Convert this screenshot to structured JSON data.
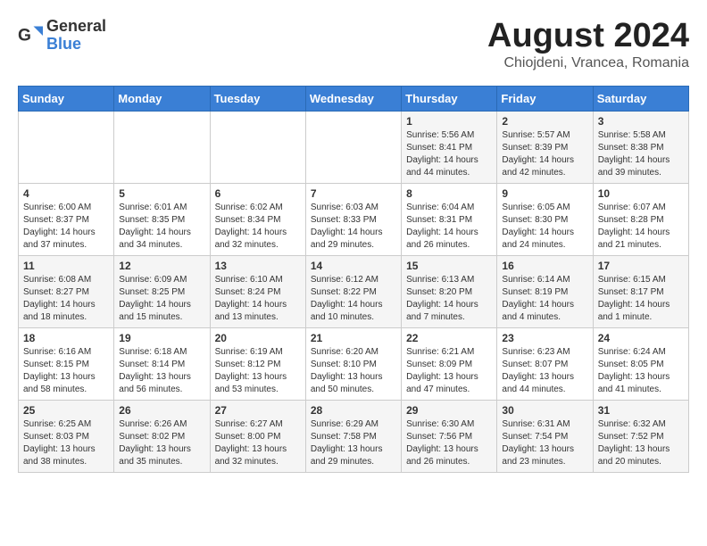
{
  "header": {
    "logo_general": "General",
    "logo_blue": "Blue",
    "month_year": "August 2024",
    "location": "Chiojdeni, Vrancea, Romania"
  },
  "weekdays": [
    "Sunday",
    "Monday",
    "Tuesday",
    "Wednesday",
    "Thursday",
    "Friday",
    "Saturday"
  ],
  "weeks": [
    [
      {
        "day": "",
        "content": ""
      },
      {
        "day": "",
        "content": ""
      },
      {
        "day": "",
        "content": ""
      },
      {
        "day": "",
        "content": ""
      },
      {
        "day": "1",
        "content": "Sunrise: 5:56 AM\nSunset: 8:41 PM\nDaylight: 14 hours and 44 minutes."
      },
      {
        "day": "2",
        "content": "Sunrise: 5:57 AM\nSunset: 8:39 PM\nDaylight: 14 hours and 42 minutes."
      },
      {
        "day": "3",
        "content": "Sunrise: 5:58 AM\nSunset: 8:38 PM\nDaylight: 14 hours and 39 minutes."
      }
    ],
    [
      {
        "day": "4",
        "content": "Sunrise: 6:00 AM\nSunset: 8:37 PM\nDaylight: 14 hours and 37 minutes."
      },
      {
        "day": "5",
        "content": "Sunrise: 6:01 AM\nSunset: 8:35 PM\nDaylight: 14 hours and 34 minutes."
      },
      {
        "day": "6",
        "content": "Sunrise: 6:02 AM\nSunset: 8:34 PM\nDaylight: 14 hours and 32 minutes."
      },
      {
        "day": "7",
        "content": "Sunrise: 6:03 AM\nSunset: 8:33 PM\nDaylight: 14 hours and 29 minutes."
      },
      {
        "day": "8",
        "content": "Sunrise: 6:04 AM\nSunset: 8:31 PM\nDaylight: 14 hours and 26 minutes."
      },
      {
        "day": "9",
        "content": "Sunrise: 6:05 AM\nSunset: 8:30 PM\nDaylight: 14 hours and 24 minutes."
      },
      {
        "day": "10",
        "content": "Sunrise: 6:07 AM\nSunset: 8:28 PM\nDaylight: 14 hours and 21 minutes."
      }
    ],
    [
      {
        "day": "11",
        "content": "Sunrise: 6:08 AM\nSunset: 8:27 PM\nDaylight: 14 hours and 18 minutes."
      },
      {
        "day": "12",
        "content": "Sunrise: 6:09 AM\nSunset: 8:25 PM\nDaylight: 14 hours and 15 minutes."
      },
      {
        "day": "13",
        "content": "Sunrise: 6:10 AM\nSunset: 8:24 PM\nDaylight: 14 hours and 13 minutes."
      },
      {
        "day": "14",
        "content": "Sunrise: 6:12 AM\nSunset: 8:22 PM\nDaylight: 14 hours and 10 minutes."
      },
      {
        "day": "15",
        "content": "Sunrise: 6:13 AM\nSunset: 8:20 PM\nDaylight: 14 hours and 7 minutes."
      },
      {
        "day": "16",
        "content": "Sunrise: 6:14 AM\nSunset: 8:19 PM\nDaylight: 14 hours and 4 minutes."
      },
      {
        "day": "17",
        "content": "Sunrise: 6:15 AM\nSunset: 8:17 PM\nDaylight: 14 hours and 1 minute."
      }
    ],
    [
      {
        "day": "18",
        "content": "Sunrise: 6:16 AM\nSunset: 8:15 PM\nDaylight: 13 hours and 58 minutes."
      },
      {
        "day": "19",
        "content": "Sunrise: 6:18 AM\nSunset: 8:14 PM\nDaylight: 13 hours and 56 minutes."
      },
      {
        "day": "20",
        "content": "Sunrise: 6:19 AM\nSunset: 8:12 PM\nDaylight: 13 hours and 53 minutes."
      },
      {
        "day": "21",
        "content": "Sunrise: 6:20 AM\nSunset: 8:10 PM\nDaylight: 13 hours and 50 minutes."
      },
      {
        "day": "22",
        "content": "Sunrise: 6:21 AM\nSunset: 8:09 PM\nDaylight: 13 hours and 47 minutes."
      },
      {
        "day": "23",
        "content": "Sunrise: 6:23 AM\nSunset: 8:07 PM\nDaylight: 13 hours and 44 minutes."
      },
      {
        "day": "24",
        "content": "Sunrise: 6:24 AM\nSunset: 8:05 PM\nDaylight: 13 hours and 41 minutes."
      }
    ],
    [
      {
        "day": "25",
        "content": "Sunrise: 6:25 AM\nSunset: 8:03 PM\nDaylight: 13 hours and 38 minutes."
      },
      {
        "day": "26",
        "content": "Sunrise: 6:26 AM\nSunset: 8:02 PM\nDaylight: 13 hours and 35 minutes."
      },
      {
        "day": "27",
        "content": "Sunrise: 6:27 AM\nSunset: 8:00 PM\nDaylight: 13 hours and 32 minutes."
      },
      {
        "day": "28",
        "content": "Sunrise: 6:29 AM\nSunset: 7:58 PM\nDaylight: 13 hours and 29 minutes."
      },
      {
        "day": "29",
        "content": "Sunrise: 6:30 AM\nSunset: 7:56 PM\nDaylight: 13 hours and 26 minutes."
      },
      {
        "day": "30",
        "content": "Sunrise: 6:31 AM\nSunset: 7:54 PM\nDaylight: 13 hours and 23 minutes."
      },
      {
        "day": "31",
        "content": "Sunrise: 6:32 AM\nSunset: 7:52 PM\nDaylight: 13 hours and 20 minutes."
      }
    ]
  ]
}
